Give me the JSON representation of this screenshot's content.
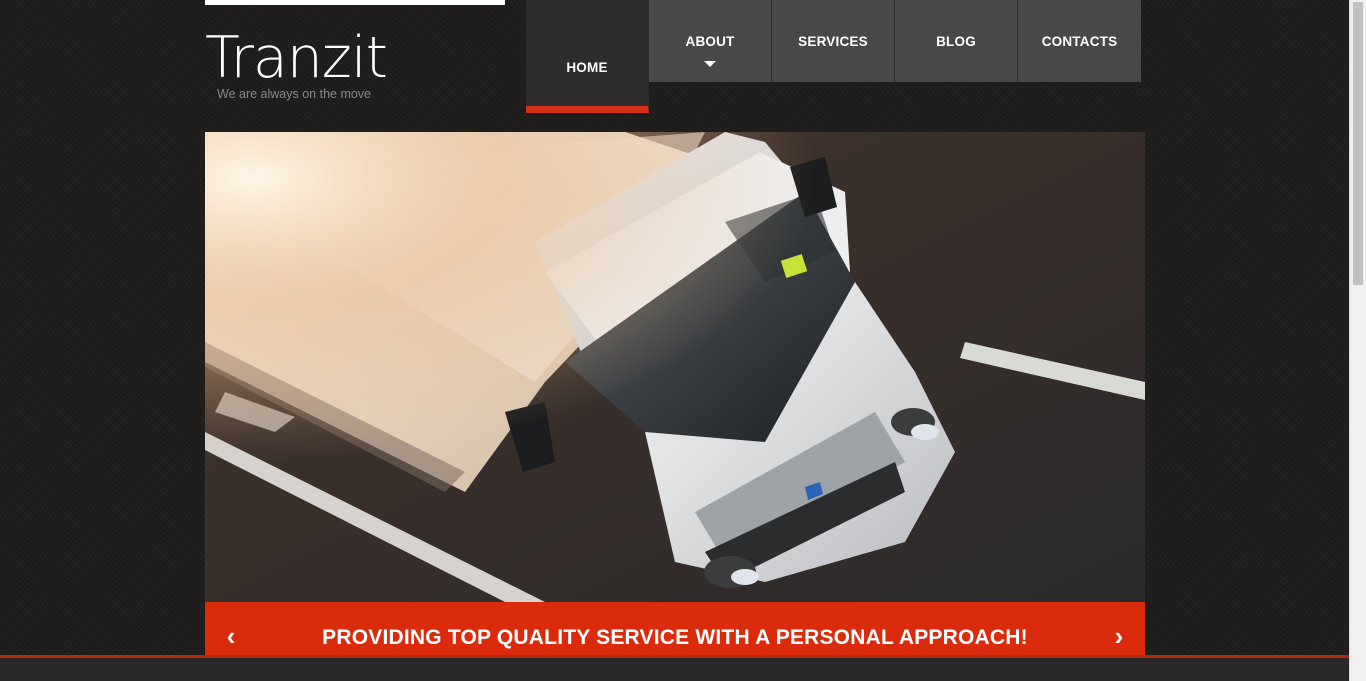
{
  "logo": {
    "title": "Tranzit",
    "tagline": "We are always on the move"
  },
  "nav": {
    "items": [
      {
        "label": "HOME",
        "active": true
      },
      {
        "label": "ABOUT",
        "has_dropdown": true
      },
      {
        "label": "SERVICES"
      },
      {
        "label": "BLOG"
      },
      {
        "label": "CONTACTS"
      }
    ]
  },
  "slider": {
    "image": "truck-photo",
    "caption": "PROVIDING TOP QUALITY SERVICE WITH A PERSONAL APPROACH!",
    "prev_icon": "chevron-left-icon",
    "next_icon": "chevron-right-icon",
    "prev_glyph": "‹",
    "next_glyph": "›"
  },
  "colors": {
    "accent": "#da2c0c",
    "nav_bg": "#4a4847",
    "page_bg": "#1f1e1d"
  }
}
